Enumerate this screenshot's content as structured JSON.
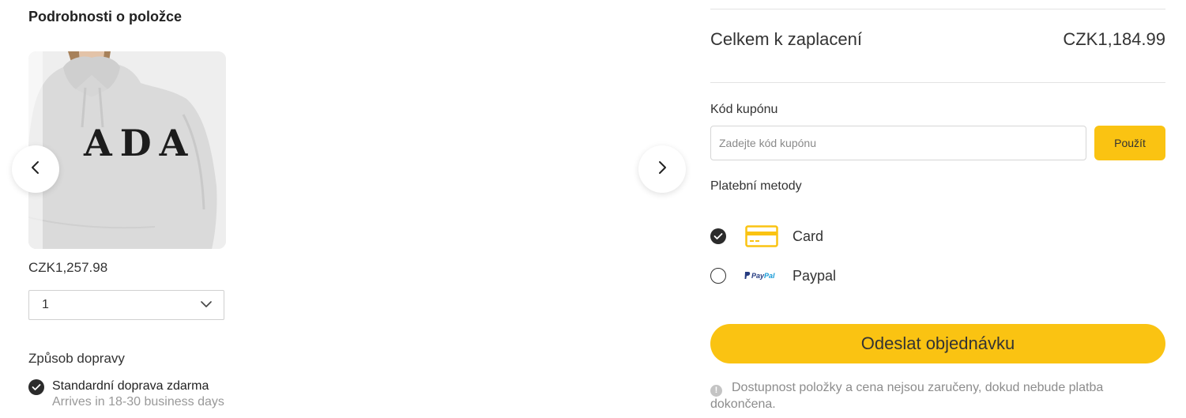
{
  "item_section": {
    "title": "Podrobnosti o položce",
    "image_print_text": "ADA",
    "price": "CZK1,257.98",
    "quantity": "1"
  },
  "shipping": {
    "title": "Způsob dopravy",
    "option_name": "Standardní doprava zdarma",
    "option_sub": "Arrives in 18-30 business days"
  },
  "summary": {
    "total_label": "Celkem k zaplacení",
    "total_value": "CZK1,184.99"
  },
  "coupon": {
    "label": "Kód kupónu",
    "placeholder": "Zadejte kód kupónu",
    "value": "",
    "apply_label": "Použít"
  },
  "payment": {
    "label": "Platební metody",
    "methods": [
      {
        "name": "Card",
        "icon": "credit-card-icon",
        "selected": true
      },
      {
        "name": "Paypal",
        "icon": "paypal-logo-icon",
        "logo_text": "PayPal",
        "selected": false
      }
    ]
  },
  "submit_label": "Odeslat objednávku",
  "notice": {
    "icon": "info-icon",
    "icon_glyph": "!",
    "text": "Dostupnost položky a cena nejsou zaručeny, dokud nebude platba dokončena."
  },
  "colors": {
    "accent": "#fac312",
    "check_fill": "#2b2b2b",
    "muted_text": "#8c8c8c"
  }
}
